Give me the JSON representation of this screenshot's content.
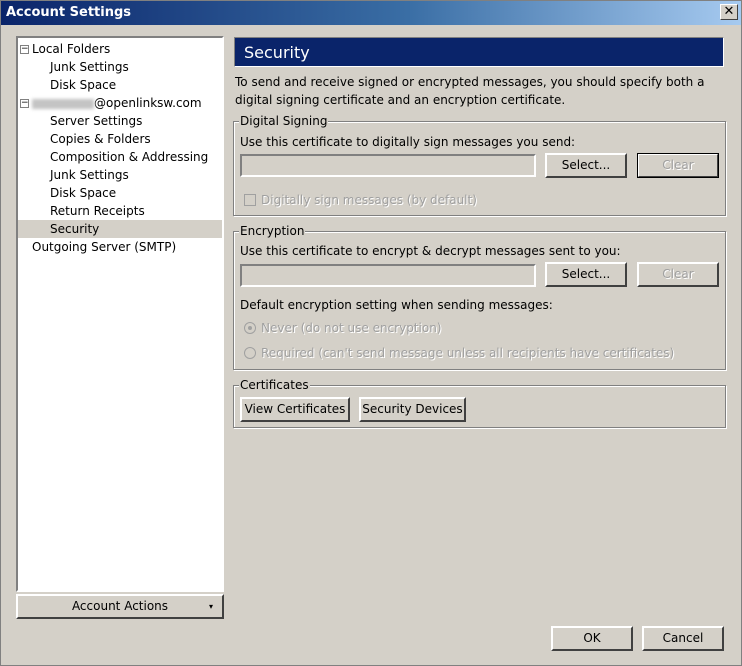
{
  "window": {
    "title": "Account Settings",
    "close_glyph": "✕"
  },
  "tree": {
    "local_folders": "Local Folders",
    "local_items": [
      "Junk Settings",
      "Disk Space"
    ],
    "account_suffix": "@openlinksw.com",
    "account_items": [
      "Server Settings",
      "Copies & Folders",
      "Composition & Addressing",
      "Junk Settings",
      "Disk Space",
      "Return Receipts",
      "Security"
    ],
    "outgoing": "Outgoing Server (SMTP)",
    "selected": "Security"
  },
  "account_actions": {
    "label": "Account Actions"
  },
  "panel": {
    "title": "Security",
    "description": "To send and receive signed or encrypted messages, you should specify both a digital signing certificate and an encryption certificate."
  },
  "digital_signing": {
    "legend": "Digital Signing",
    "label": "Use this certificate to digitally sign messages you send:",
    "value": "",
    "select_label": "Select...",
    "clear_label": "Clear",
    "checkbox_label": "Digitally sign messages (by default)"
  },
  "encryption": {
    "legend": "Encryption",
    "label": "Use this certificate to encrypt & decrypt messages sent to you:",
    "value": "",
    "select_label": "Select...",
    "clear_label": "Clear",
    "default_label": "Default encryption setting when sending messages:",
    "never_label": "Never (do not use encryption)",
    "required_label": "Required (can't send message unless all recipients have certificates)"
  },
  "certificates": {
    "legend": "Certificates",
    "view_label": "View Certificates",
    "devices_label": "Security Devices"
  },
  "footer": {
    "ok_label": "OK",
    "cancel_label": "Cancel"
  }
}
